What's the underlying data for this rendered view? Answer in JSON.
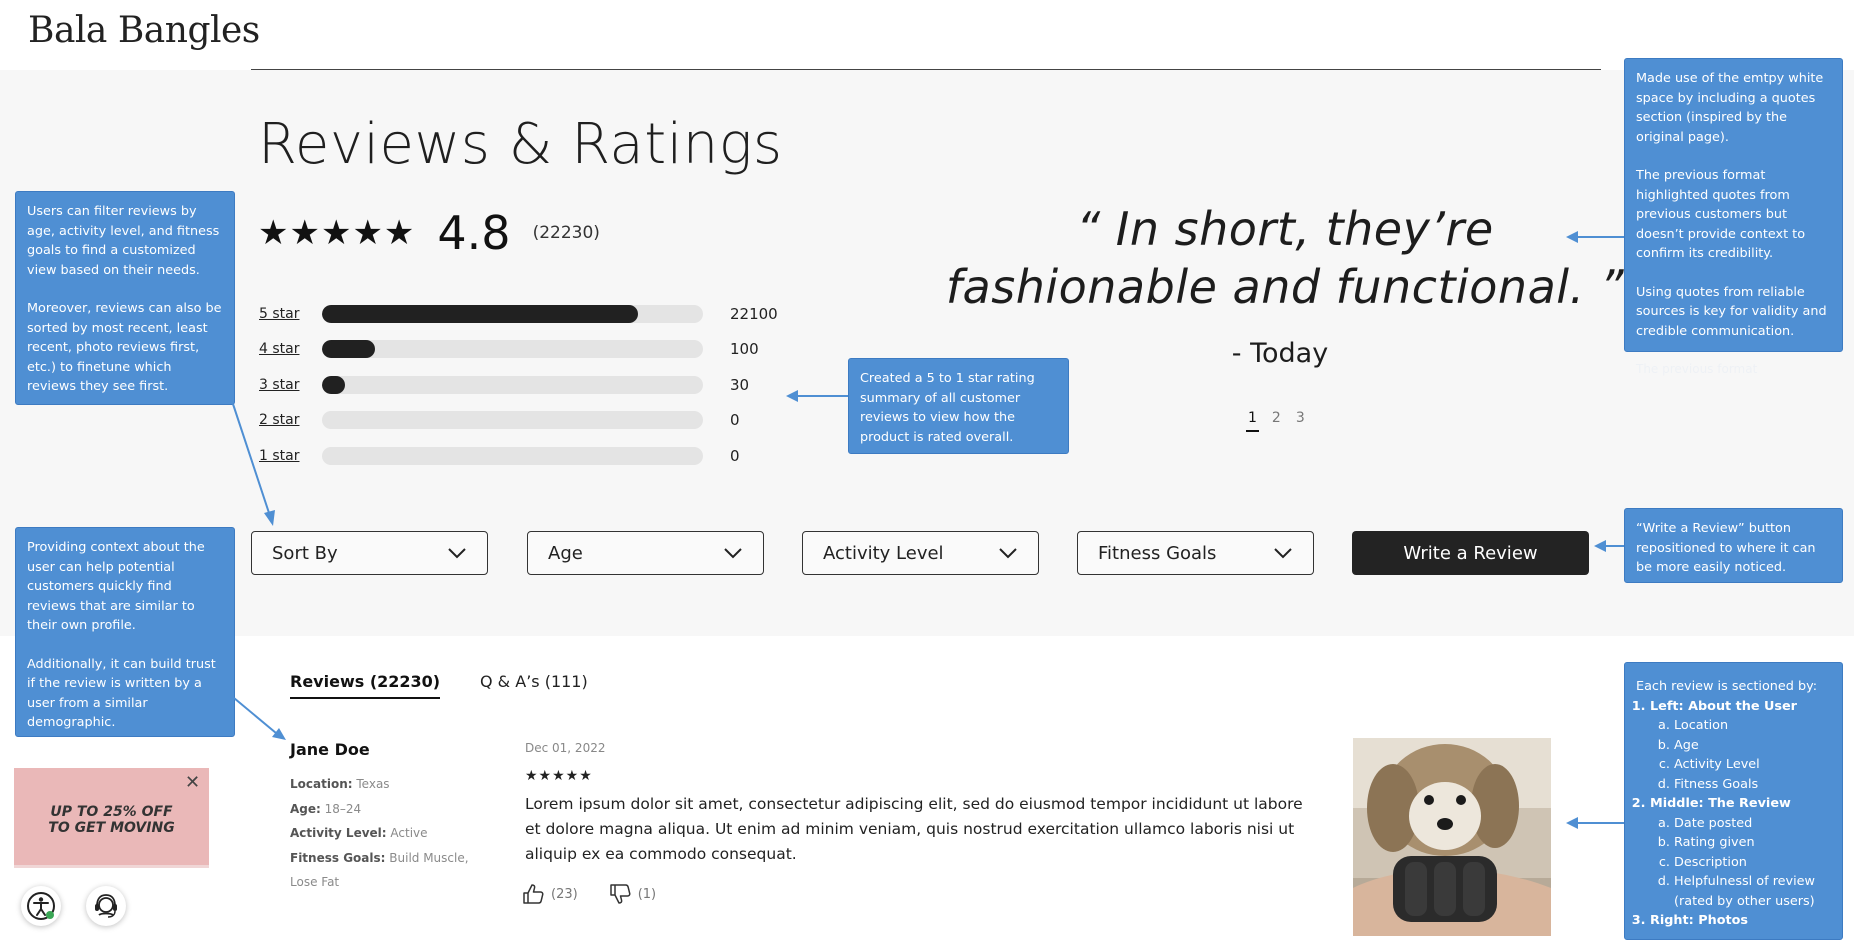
{
  "header": {
    "brand": "Bala Bangles"
  },
  "summary": {
    "title": "Reviews & Ratings",
    "stars": "★★★★★",
    "average": "4.8",
    "count": "(22230)"
  },
  "distribution": [
    {
      "label": "5 star",
      "count": "22100",
      "fill": 0.83
    },
    {
      "label": "4 star",
      "count": "100",
      "fill": 0.14
    },
    {
      "label": "3 star",
      "count": "30",
      "fill": 0.06
    },
    {
      "label": "2 star",
      "count": "0",
      "fill": 0
    },
    {
      "label": "1 star",
      "count": "0",
      "fill": 0
    }
  ],
  "quote": {
    "text": "“ In short, they’re fashionable and functional. ”",
    "source": "- Today",
    "pages": [
      "1",
      "2",
      "3"
    ],
    "active_page": "1"
  },
  "filters": {
    "sort": "Sort By",
    "age": "Age",
    "activity": "Activity Level",
    "goals": "Fitness Goals",
    "write_review": "Write a Review"
  },
  "tabs": {
    "reviews": "Reviews (22230)",
    "qa": "Q & A’s (111)"
  },
  "review": {
    "name": "Jane Doe",
    "location_label": "Location:",
    "location": "Texas",
    "age_label": "Age:",
    "age": "18–24",
    "activity_label": "Activity Level:",
    "activity": "Active",
    "goals_label": "Fitness Goals:",
    "goals_1": "Build Muscle,",
    "goals_2": "Lose Fat",
    "date": "Dec 01, 2022",
    "stars": "★★★★★",
    "text": "Lorem ipsum dolor sit amet, consectetur adipiscing elit, sed do eiusmod tempor incididunt ut labore et dolore magna aliqua. Ut enim ad minim veniam, quis nostrud exercitation ullamco laboris nisi ut aliquip ex ea commodo consequat.",
    "likes": "(23)",
    "dislikes": "(1)"
  },
  "promo": {
    "line1": "UP TO 25% OFF",
    "line2": "TO GET MOVING",
    "close": "✕"
  },
  "notes": {
    "filter_1": "Users can filter reviews by age, activity level, and fitness goals to find a customized view based on their needs.",
    "filter_2": "Moreover, reviews can also be sorted by most recent, least recent, photo reviews first, etc.) to finetune which reviews they see first.",
    "context_1": "Providing context about the user can help potential customers quickly find reviews that are similar to their own profile.",
    "context_2": "Additionally, it can build trust if the review is written by a user from a similar demographic.",
    "summary": "Created a 5 to 1 star rating summary of all customer reviews to view how the product is rated overall.",
    "quotes_1": "Made use of the emtpy white space by including a quotes section (inspired by the original page).",
    "quotes_2": "The previous format highlighted quotes from previous customers but doesn’t provide context to confirm its credibility.",
    "quotes_3": "Using quotes from reliable sources is key for validity and credible communication.",
    "quotes_ghost": "The previous format",
    "write": "“Write a Review” button repositioned to where it can be more easily noticed.",
    "sections_intro": "Each review is sectioned by:",
    "left_title": "Left: About the User",
    "left_items": [
      "Location",
      "Age",
      "Activity Level",
      "Fitness Goals"
    ],
    "middle_title": "Middle: The Review",
    "middle_items": [
      "Date posted",
      "Rating given",
      "Description",
      "Helpfulnessl of review (rated by other users)"
    ],
    "right_title": "Right: Photos"
  },
  "colors": {
    "annotation": "#4f8fd3",
    "bar_fill": "#212121",
    "bar_track": "#e4e4e4",
    "promo": "#eab8b8"
  },
  "icons": [
    "chevron-down-icon",
    "thumbs-up-icon",
    "thumbs-down-icon",
    "close-icon",
    "accessibility-icon",
    "support-headset-icon"
  ]
}
